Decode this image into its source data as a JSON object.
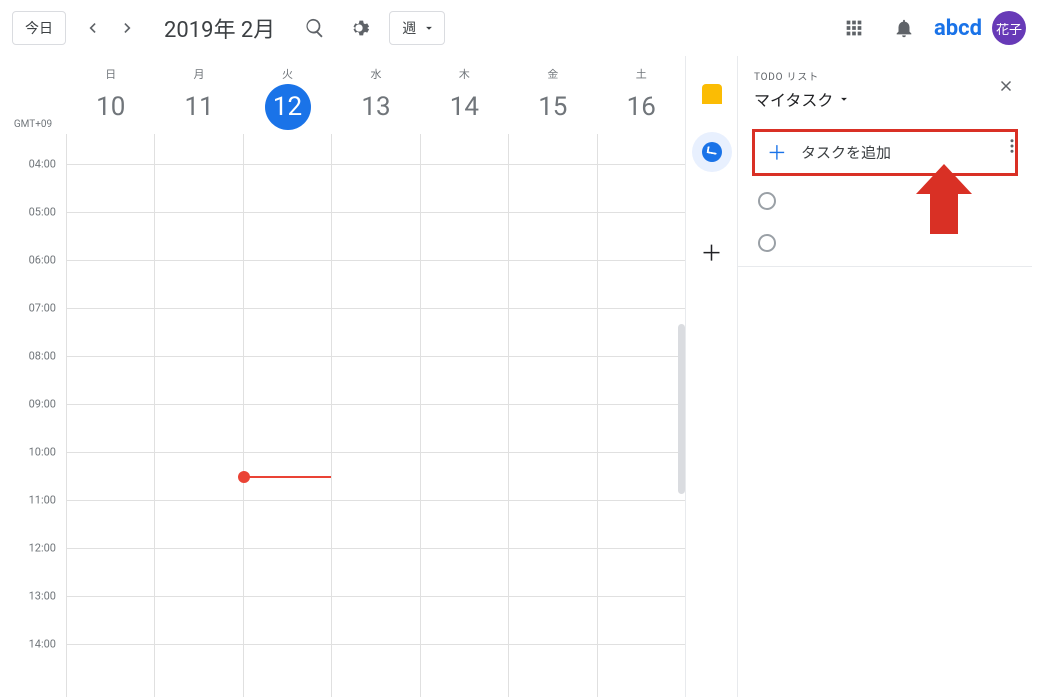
{
  "header": {
    "today": "今日",
    "title": "2019年 2月",
    "view_label": "週",
    "brand": "abcd",
    "avatar_initial": "花子"
  },
  "calendar": {
    "tz": "GMT+09",
    "days": [
      {
        "dow": "日",
        "dom": "10",
        "today": false
      },
      {
        "dow": "月",
        "dom": "11",
        "today": false
      },
      {
        "dow": "火",
        "dom": "12",
        "today": true
      },
      {
        "dow": "水",
        "dom": "13",
        "today": false
      },
      {
        "dow": "木",
        "dom": "14",
        "today": false
      },
      {
        "dow": "金",
        "dom": "15",
        "today": false
      },
      {
        "dow": "土",
        "dom": "16",
        "today": false
      }
    ],
    "hours": [
      "04:00",
      "05:00",
      "06:00",
      "07:00",
      "08:00",
      "09:00",
      "10:00",
      "11:00",
      "12:00",
      "13:00",
      "14:00"
    ],
    "now_hour_index": 6,
    "now_fraction": 0.5,
    "now_day_index": 2
  },
  "tasks_panel": {
    "small_title": "TODO リスト",
    "list_name": "マイタスク",
    "add_label": "タスクを追加",
    "items": [
      "",
      ""
    ]
  }
}
